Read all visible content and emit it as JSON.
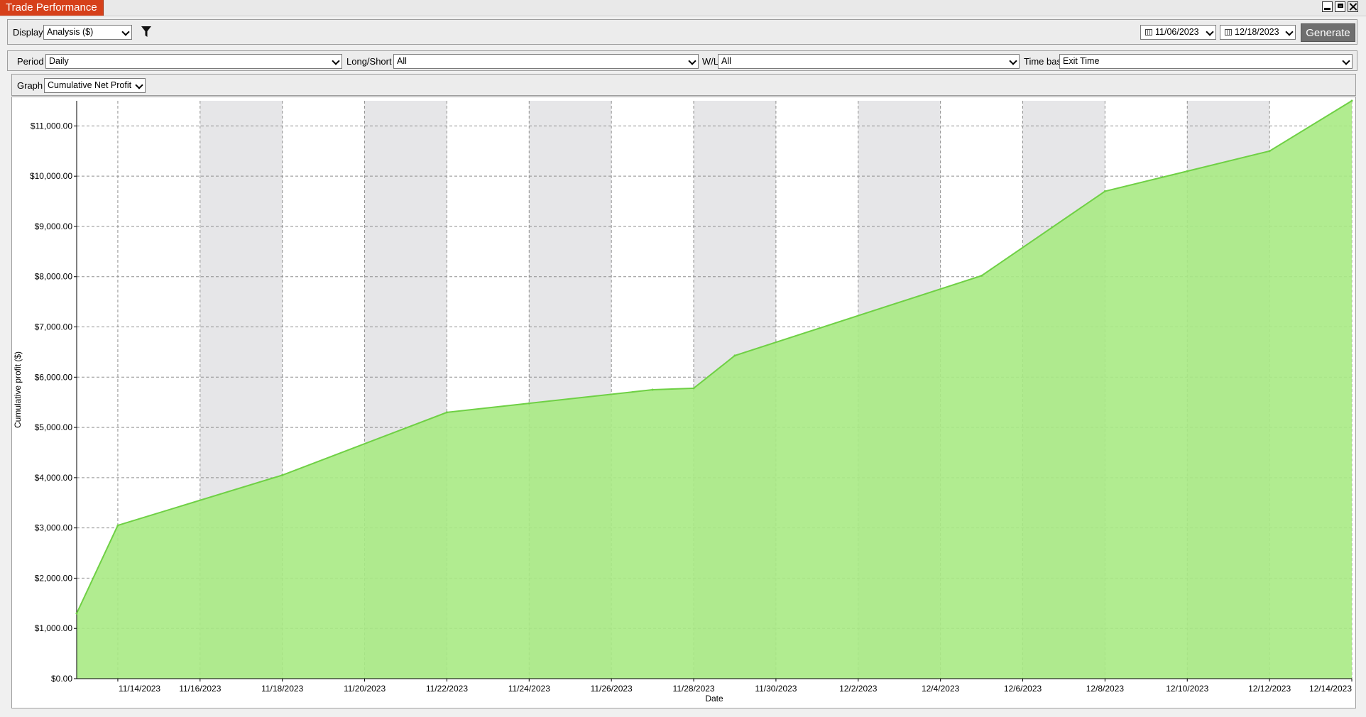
{
  "window": {
    "title": "Trade Performance"
  },
  "toolbar": {
    "display_label": "Display",
    "display_value": "Analysis ($)",
    "start_date": "11/06/2023",
    "end_date": "12/18/2023",
    "generate_label": "Generate"
  },
  "filters": {
    "period_label": "Period",
    "period_value": "Daily",
    "longshort_label": "Long/Short",
    "longshort_value": "All",
    "wl_label": "W/L",
    "wl_value": "All",
    "timebase_label": "Time base",
    "timebase_value": "Exit Time"
  },
  "graph": {
    "label": "Graph",
    "value": "Cumulative Net Profit"
  },
  "colors": {
    "fill": "#a8ea84",
    "line": "#6fd045",
    "band": "#e6e6e8",
    "grid": "#8f8f8f"
  },
  "chart_data": {
    "type": "area",
    "title": "",
    "xlabel": "Date",
    "ylabel": "Cumulative profit ($)",
    "x": [
      "2023-11-13",
      "2023-11-14",
      "2023-11-18",
      "2023-11-22",
      "2023-11-24",
      "2023-11-27",
      "2023-11-28",
      "2023-11-29",
      "2023-12-05",
      "2023-12-08",
      "2023-12-10",
      "2023-12-12",
      "2023-12-14"
    ],
    "series": [
      {
        "values": [
          1300,
          3050,
          4050,
          5300,
          5480,
          5750,
          5780,
          6430,
          8020,
          9700,
          10100,
          10500,
          11500
        ]
      }
    ],
    "xlim": [
      "2023-11-13",
      "2023-12-14"
    ],
    "ylim": [
      0,
      11500
    ],
    "x_ticks": [
      "11/14/2023",
      "11/16/2023",
      "11/18/2023",
      "11/20/2023",
      "11/22/2023",
      "11/24/2023",
      "11/26/2023",
      "11/28/2023",
      "11/30/2023",
      "12/2/2023",
      "12/4/2023",
      "12/6/2023",
      "12/8/2023",
      "12/10/2023",
      "12/12/2023",
      "12/14/2023"
    ],
    "y_ticks": [
      "$0.00",
      "$1,000.00",
      "$2,000.00",
      "$3,000.00",
      "$4,000.00",
      "$5,000.00",
      "$6,000.00",
      "$7,000.00",
      "$8,000.00",
      "$9,000.00",
      "$10,000.00",
      "$11,000.00"
    ],
    "y_tick_values": [
      0,
      1000,
      2000,
      3000,
      4000,
      5000,
      6000,
      7000,
      8000,
      9000,
      10000,
      11000
    ],
    "shaded_bands": [
      [
        "2023-11-16",
        "2023-11-18"
      ],
      [
        "2023-11-20",
        "2023-11-22"
      ],
      [
        "2023-11-24",
        "2023-11-26"
      ],
      [
        "2023-11-28",
        "2023-11-30"
      ],
      [
        "2023-12-02",
        "2023-12-04"
      ],
      [
        "2023-12-06",
        "2023-12-08"
      ],
      [
        "2023-12-10",
        "2023-12-12"
      ]
    ],
    "grid": true,
    "legend": "none"
  }
}
